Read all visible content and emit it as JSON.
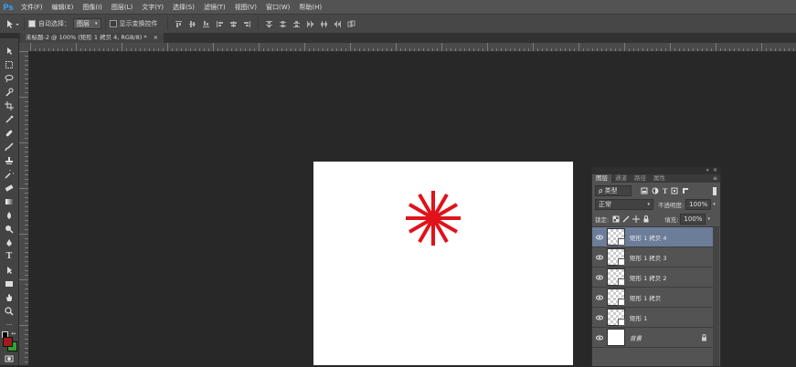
{
  "app": {
    "logo": "Ps"
  },
  "menu": [
    "文件(F)",
    "编辑(E)",
    "图像(I)",
    "图层(L)",
    "文字(Y)",
    "选择(S)",
    "滤镜(T)",
    "视图(V)",
    "窗口(W)",
    "帮助(H)"
  ],
  "options": {
    "auto_select_label": "自动选择：",
    "auto_select_value": "图层",
    "show_transform_label": "显示变换控件"
  },
  "document": {
    "tab_title": "未标题-2 @ 100% (矩形 1 拷贝 4, RGB/8) *",
    "tab_close": "×"
  },
  "canvas": {
    "star_color": "#e0121a",
    "background": "#ffffff"
  },
  "layers_panel": {
    "tabs": [
      "图层",
      "通道",
      "路径",
      "属性"
    ],
    "filter_kind": "ρ 类型",
    "blend_mode": "正常",
    "opacity_label": "不透明度:",
    "opacity_value": "100%",
    "lock_label": "锁定:",
    "fill_label": "填充:",
    "fill_value": "100%",
    "layers": [
      {
        "name": "矩形 1 拷贝 4",
        "selected": true
      },
      {
        "name": "矩形 1 拷贝 3",
        "selected": false
      },
      {
        "name": "矩形 1 拷贝 2",
        "selected": false
      },
      {
        "name": "矩形 1 拷贝",
        "selected": false
      },
      {
        "name": "矩形 1",
        "selected": false
      },
      {
        "name": "背景",
        "selected": false
      }
    ]
  },
  "colors": {
    "foreground": "#a11b1b",
    "background": "#2fa12f",
    "selected_layer": "#6b7d99"
  }
}
